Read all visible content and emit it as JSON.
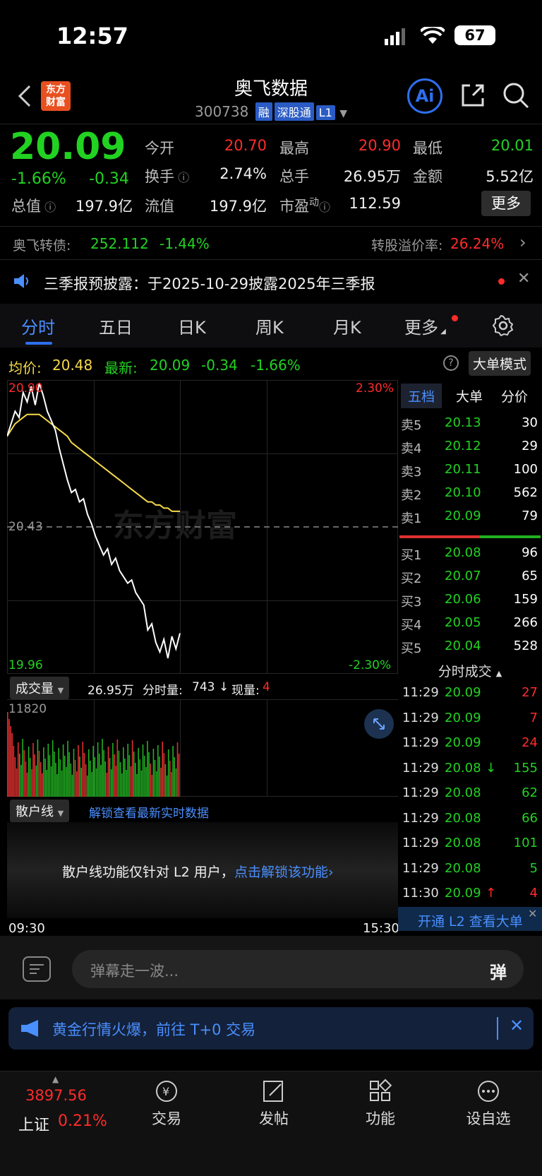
{
  "status_bar": {
    "time": "12:57",
    "battery": "67"
  },
  "header": {
    "logo_line1": "东方",
    "logo_line2": "财富",
    "title": "奥飞数据",
    "code": "300738",
    "tags": [
      "融",
      "深股通",
      "L1"
    ],
    "ai_label": "Ai"
  },
  "quote": {
    "price": "20.09",
    "change_pct": "-1.66%",
    "change_amt": "-0.34",
    "open_label": "今开",
    "open": "20.70",
    "high_label": "最高",
    "high": "20.90",
    "low_label": "最低",
    "low": "20.01",
    "turnover_label": "换手",
    "turnover": "2.74%",
    "volume_label": "总手",
    "volume": "26.95万",
    "amount_label": "金额",
    "amount": "5.52亿",
    "total_cap_label": "总值",
    "total_cap": "197.9亿",
    "float_cap_label": "流值",
    "float_cap": "197.9亿",
    "pe_label": "市盈",
    "pe_sup": "动",
    "pe": "112.59",
    "more_label": "更多"
  },
  "bond": {
    "label": "奥飞转债:",
    "price": "252.112",
    "change": "-1.44%",
    "premium_label": "转股溢价率:",
    "premium": "26.24%"
  },
  "notice": {
    "text": "三季报预披露：于2025-10-29披露2025年三季报"
  },
  "tabs": [
    "分时",
    "五日",
    "日K",
    "周K",
    "月K",
    "更多"
  ],
  "chart_header": {
    "avg_label": "均价:",
    "avg": "20.48",
    "latest_label": "最新:",
    "latest": "20.09",
    "chg": "-0.34",
    "chg_pct": "-1.66%",
    "big_order_mode": "大单模式"
  },
  "chart_axis": {
    "top_price": "20.90",
    "mid_price": "20.43",
    "bottom_price": "19.96",
    "top_pct": "2.30%",
    "bottom_pct": "-2.30%",
    "start_time": "09:30",
    "end_time": "15:30",
    "watermark": "东方财富"
  },
  "chart_data": {
    "type": "line",
    "ylim": [
      19.96,
      20.9
    ],
    "x_range": [
      "09:30",
      "15:00"
    ],
    "series": [
      {
        "name": "最新",
        "color": "#ffffff",
        "values": [
          20.72,
          20.76,
          20.8,
          20.78,
          20.86,
          20.83,
          20.88,
          20.82,
          20.89,
          20.85,
          20.8,
          20.77,
          20.74,
          20.68,
          20.63,
          20.58,
          20.54,
          20.55,
          20.51,
          20.52,
          20.47,
          20.44,
          20.4,
          20.37,
          20.34,
          20.36,
          20.31,
          20.33,
          20.29,
          20.27,
          20.25,
          20.26,
          20.22,
          20.2,
          20.18,
          20.1,
          20.12,
          20.06,
          20.03,
          20.07,
          20.01,
          20.08,
          20.04,
          20.09
        ]
      },
      {
        "name": "均价",
        "color": "#f5d94a",
        "values": [
          20.72,
          20.74,
          20.76,
          20.77,
          20.78,
          20.79,
          20.79,
          20.79,
          20.79,
          20.78,
          20.77,
          20.76,
          20.75,
          20.74,
          20.73,
          20.72,
          20.7,
          20.69,
          20.68,
          20.67,
          20.66,
          20.65,
          20.64,
          20.63,
          20.62,
          20.61,
          20.6,
          20.59,
          20.58,
          20.57,
          20.56,
          20.55,
          20.54,
          20.53,
          20.52,
          20.51,
          20.51,
          20.5,
          20.5,
          20.49,
          20.49,
          20.48,
          20.48,
          20.48
        ]
      }
    ],
    "ref_price": 20.43
  },
  "volume": {
    "label": "成交量",
    "total": "26.95万",
    "tick_label": "分时量:",
    "tick": "743",
    "now_label": "现量:",
    "now": "4",
    "max": "11820"
  },
  "retail": {
    "label": "散户线",
    "unlock_link": "解锁查看最新实时数据",
    "msg": "散户线功能仅针对 L2 用户，",
    "msg_link": "点击解锁该功能"
  },
  "orderbook": {
    "tabs": [
      "五档",
      "大单",
      "分价"
    ],
    "asks": [
      {
        "label": "卖5",
        "price": "20.13",
        "vol": "30"
      },
      {
        "label": "卖4",
        "price": "20.12",
        "vol": "29"
      },
      {
        "label": "卖3",
        "price": "20.11",
        "vol": "100"
      },
      {
        "label": "卖2",
        "price": "20.10",
        "vol": "562"
      },
      {
        "label": "卖1",
        "price": "20.09",
        "vol": "79"
      }
    ],
    "bids": [
      {
        "label": "买1",
        "price": "20.08",
        "vol": "96"
      },
      {
        "label": "买2",
        "price": "20.07",
        "vol": "65"
      },
      {
        "label": "买3",
        "price": "20.06",
        "vol": "159"
      },
      {
        "label": "买4",
        "price": "20.05",
        "vol": "266"
      },
      {
        "label": "买5",
        "price": "20.04",
        "vol": "528"
      }
    ]
  },
  "trades": {
    "title": "分时成交",
    "rows": [
      {
        "time": "11:29",
        "price": "20.09",
        "vol": "27",
        "dir": "",
        "vcolor": "red"
      },
      {
        "time": "11:29",
        "price": "20.09",
        "vol": "7",
        "dir": "",
        "vcolor": "red"
      },
      {
        "time": "11:29",
        "price": "20.09",
        "vol": "24",
        "dir": "",
        "vcolor": "red"
      },
      {
        "time": "11:29",
        "price": "20.08",
        "vol": "155",
        "dir": "↓",
        "vcolor": "green"
      },
      {
        "time": "11:29",
        "price": "20.08",
        "vol": "62",
        "dir": "",
        "vcolor": "green"
      },
      {
        "time": "11:29",
        "price": "20.08",
        "vol": "66",
        "dir": "",
        "vcolor": "green"
      },
      {
        "time": "11:29",
        "price": "20.08",
        "vol": "101",
        "dir": "",
        "vcolor": "green"
      },
      {
        "time": "11:29",
        "price": "20.08",
        "vol": "5",
        "dir": "",
        "vcolor": "green"
      },
      {
        "time": "11:30",
        "price": "20.09",
        "vol": "4",
        "dir": "↑",
        "vcolor": "red"
      }
    ],
    "l2_banner": "开通 L2 查看大单"
  },
  "danmu": {
    "placeholder": "弹幕走一波...",
    "btn": "弹"
  },
  "promo": {
    "text": "黄金行情火爆，前往 T+0 交易"
  },
  "bottom_nav": {
    "index_value": "3897.56",
    "index_name": "上证",
    "index_pct": "0.21%",
    "items": [
      "交易",
      "发帖",
      "功能",
      "设自选"
    ]
  }
}
